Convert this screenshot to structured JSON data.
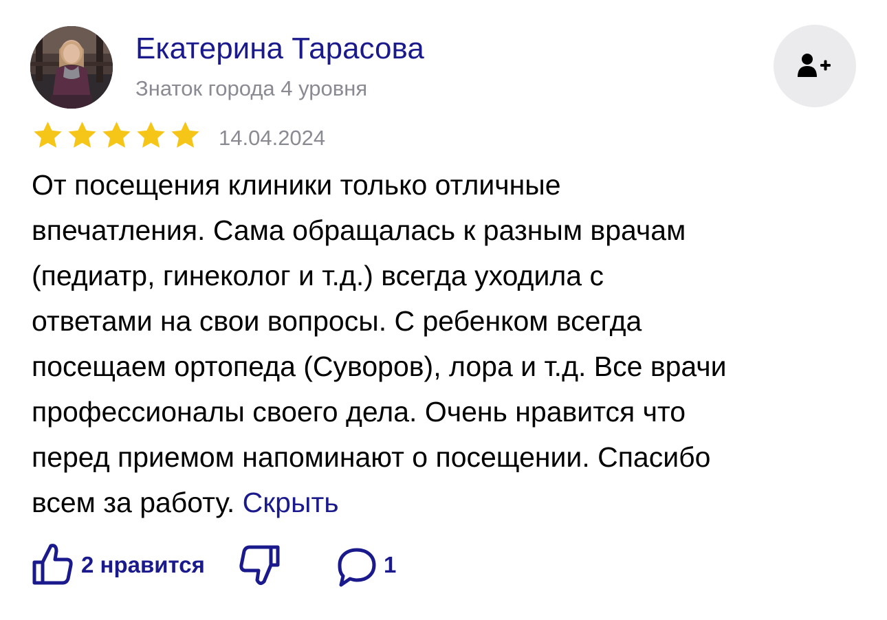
{
  "author": {
    "name": "Екатерина Тарасова",
    "level": "Знаток города 4 уровня"
  },
  "review": {
    "rating": 5,
    "max_rating": 5,
    "date": "14.04.2024",
    "text_lines": [
      "От посещения клиники только отличные",
      "впечатления. Сама обращалась к разным врачам",
      "(педиатр, гинеколог и т.д.) всегда уходила с",
      "ответами на свои вопросы. С ребенком всегда",
      "посещаем ортопеда (Суворов), лора и т.д. Все врачи",
      "профессионалы своего дела. Очень нравится что",
      "перед приемом напоминают о посещении. Спасибо",
      "всем за работу."
    ],
    "hide_label": "Скрыть"
  },
  "actions": {
    "likes_label": "2 нравится",
    "comments_count": "1"
  },
  "colors": {
    "link": "#1a1a8c",
    "star": "#f5c518",
    "muted": "#8a8a92",
    "button_bg": "#ebebed"
  },
  "icons": [
    "avatar-photo",
    "add-user-icon",
    "star-icon",
    "thumbs-up-icon",
    "thumbs-down-icon",
    "comment-icon"
  ]
}
